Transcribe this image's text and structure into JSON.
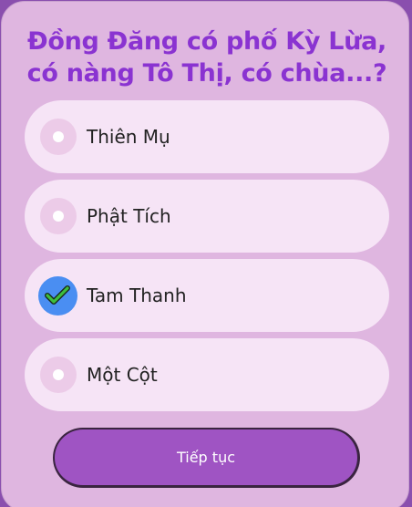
{
  "question": {
    "line1": "Đồng Đăng có phố Kỳ Lừa,",
    "line2": "có nàng Tô Thị, có chùa...?"
  },
  "options": [
    {
      "label": "Thiên Mụ",
      "selected": false
    },
    {
      "label": "Phật Tích",
      "selected": false
    },
    {
      "label": "Tam Thanh",
      "selected": true
    },
    {
      "label": "Một Cột",
      "selected": false
    }
  ],
  "next_button": {
    "label": "Tiếp tục"
  },
  "colors": {
    "background": "#8a4fae",
    "card": "#dfb6e0",
    "question_text": "#8a33d1",
    "option_bg": "#f6e4f6",
    "radio_selected": "#4a8ef2",
    "check_mark": "#3dbf3d",
    "button": "#9f54c3"
  },
  "icons": {
    "unselected": "radio-empty-icon",
    "selected": "checkmark-icon"
  }
}
